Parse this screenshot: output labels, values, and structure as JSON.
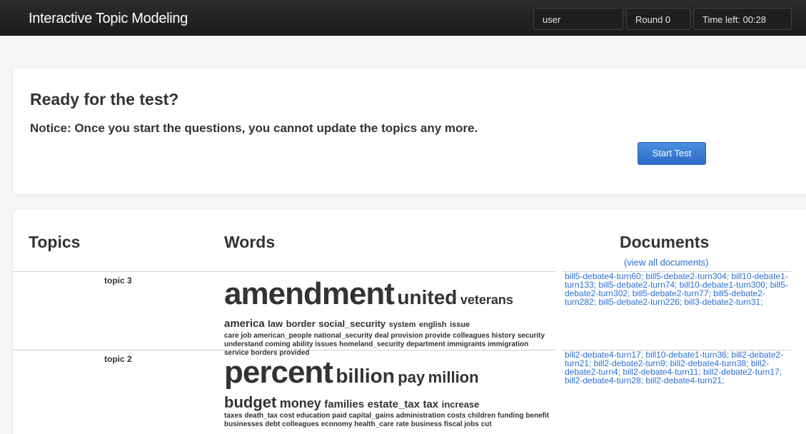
{
  "navbar": {
    "title": "Interactive Topic Modeling",
    "user": "user",
    "round": "Round 0",
    "time_left": "Time left: 00:28"
  },
  "test_panel": {
    "title": "Ready for the test?",
    "notice": "Notice: Once you start the questions, you cannot update the topics any more.",
    "start_button": "Start Test"
  },
  "topics_panel": {
    "headers": {
      "topics": "Topics",
      "words": "Words",
      "documents": "Documents"
    },
    "view_all": "(view all documents)",
    "topics": [
      {
        "label": "topic 3",
        "words_l1": [
          "amendment",
          "united",
          "veterans"
        ],
        "words_l2": [
          "america",
          "law",
          "border",
          "social_security",
          "system",
          "english",
          "issue"
        ],
        "words_l3": "care job american_people national_security deal provision provide colleagues history security understand coming ability issues homeland_security department immigrants immigration service borders provided",
        "documents": [
          "bill5-debate4-turn60",
          "bill5-debate2-turn304",
          "bill10-debate1-turn133",
          "bill5-debate2-turn74",
          "bill10-debate1-turn300",
          "bill5-debate2-turn302",
          "bill5-debate2-turn77",
          "bill5-debate2-turn282",
          "bill5-debate2-turn226",
          "bill3-debate2-turn31"
        ]
      },
      {
        "label": "topic 2",
        "words_l1": [
          "percent",
          "billion",
          "pay",
          "million"
        ],
        "words_l2": [
          "budget",
          "money",
          "families",
          "estate_tax",
          "tax",
          "increase"
        ],
        "words_l3": "taxes death_tax cost education paid capital_gains administration costs children funding benefit businesses debt colleagues economy health_care rate business fiscal jobs cut",
        "documents": [
          "bill2-debate4-turn17",
          "bill10-debate1-turn36",
          "bill2-debate2-turn21",
          "bill2-debate2-turn9",
          "bill2-debate4-turn38",
          "bill2-debate2-turn4",
          "bill2-debate4-turn11",
          "bill2-debate2-turn17",
          "bill2-debate4-turn28",
          "bill2-debate4-turn21"
        ]
      }
    ]
  }
}
